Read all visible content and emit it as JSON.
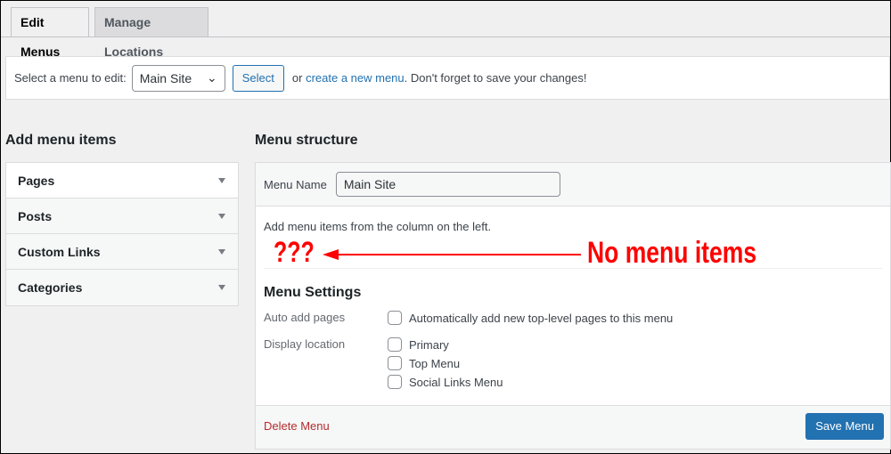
{
  "tabs": [
    {
      "label": "Edit Menus",
      "active": true
    },
    {
      "label": "Manage Locations",
      "active": false
    }
  ],
  "select_bar": {
    "label": "Select a menu to edit:",
    "selected": "Main Site",
    "button": "Select",
    "or": "or",
    "create_link": "create a new menu",
    "suffix": ". Don't forget to save your changes!"
  },
  "left": {
    "title": "Add menu items",
    "items": [
      "Pages",
      "Posts",
      "Custom Links",
      "Categories"
    ]
  },
  "right": {
    "title": "Menu structure",
    "menu_name_label": "Menu Name",
    "menu_name_value": "Main Site",
    "instructions": "Add menu items from the column on the left.",
    "settings_title": "Menu Settings",
    "auto_add_label": "Auto add pages",
    "auto_add_option": "Automatically add new top-level pages to this menu",
    "display_location_label": "Display location",
    "locations": [
      "Primary",
      "Top Menu",
      "Social Links Menu"
    ],
    "delete_link": "Delete Menu",
    "save_button": "Save Menu"
  },
  "annotation": {
    "marks": "???",
    "text": "No menu items",
    "color": "#ff0000"
  },
  "colors": {
    "accent": "#2271b1",
    "delete": "#b32d2e"
  }
}
